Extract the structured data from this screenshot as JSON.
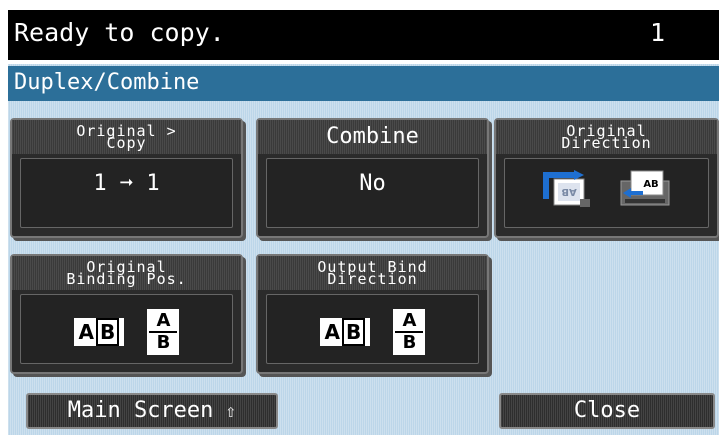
{
  "status": {
    "message": "Ready to copy.",
    "count": "1"
  },
  "panel": {
    "title": "Duplex/Combine"
  },
  "buttons": {
    "original_copy": {
      "label_line1": "Original >",
      "label_line2": "Copy",
      "value": "1 ➞ 1"
    },
    "combine": {
      "label": "Combine",
      "value": "No"
    },
    "original_direction": {
      "label_line1": "Original",
      "label_line2": "Direction",
      "icons": [
        "original-direction-top-icon",
        "original-direction-left-icon"
      ]
    },
    "original_binding_pos": {
      "label_line1": "Original",
      "label_line2": "Binding Pos.",
      "icons": [
        "left-binding-icon",
        "top-binding-icon"
      ]
    },
    "output_bind_direction": {
      "label_line1": "Output Bind",
      "label_line2": "Direction",
      "icons": [
        "left-binding-icon",
        "top-binding-icon"
      ]
    }
  },
  "ab_glyphs": {
    "a": "A",
    "b": "B"
  },
  "footer": {
    "main_screen": "Main Screen",
    "close": "Close"
  },
  "colors": {
    "status_bar": "#000000",
    "panel_bg": "#bcd6e9",
    "panel_title": "#2c6f99",
    "button": "#2b2b2b",
    "icon_blue": "#1e6fd1"
  }
}
